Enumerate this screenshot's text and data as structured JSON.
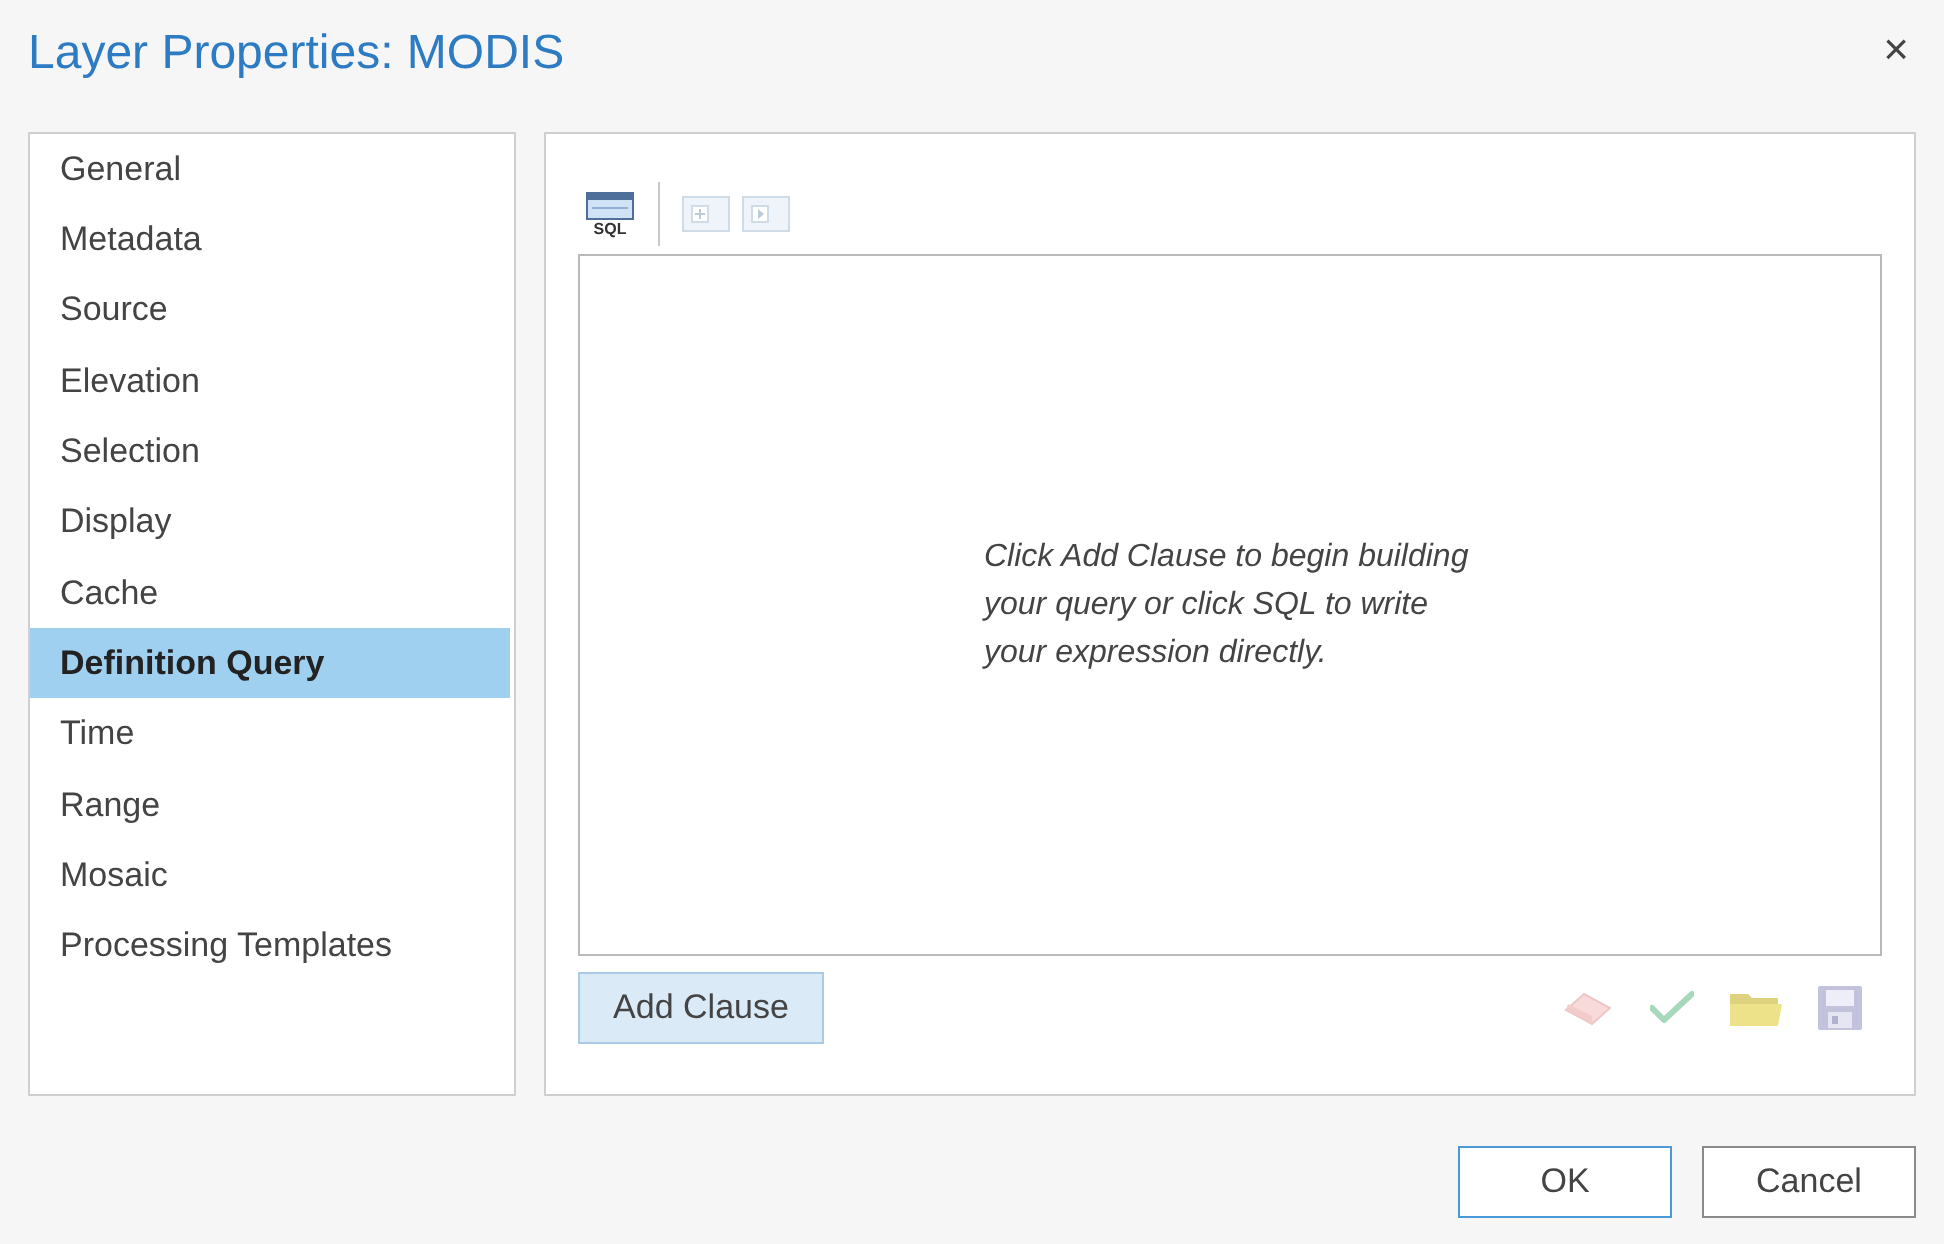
{
  "window": {
    "title": "Layer Properties: MODIS",
    "close_label": "×"
  },
  "sidebar": {
    "items": [
      {
        "label": "General",
        "selected": false
      },
      {
        "label": "Metadata",
        "selected": false
      },
      {
        "label": "Source",
        "selected": false
      },
      {
        "label": "Elevation",
        "selected": false
      },
      {
        "label": "Selection",
        "selected": false
      },
      {
        "label": "Display",
        "selected": false
      },
      {
        "label": "Cache",
        "selected": false
      },
      {
        "label": "Definition Query",
        "selected": true
      },
      {
        "label": "Time",
        "selected": false
      },
      {
        "label": "Range",
        "selected": false
      },
      {
        "label": "Mosaic",
        "selected": false
      },
      {
        "label": "Processing Templates",
        "selected": false
      }
    ]
  },
  "toolbar": {
    "buttons": [
      {
        "kind": "sql",
        "label": "SQL",
        "disabled": false
      },
      {
        "kind": "add_clause",
        "disabled": true
      },
      {
        "kind": "add_group",
        "disabled": true
      }
    ]
  },
  "query_area": {
    "hint": "Click Add Clause to begin building your query or click SQL to write your expression directly."
  },
  "add_clause_button": {
    "label": "Add Clause"
  },
  "actions": [
    {
      "kind": "clear"
    },
    {
      "kind": "verify"
    },
    {
      "kind": "load"
    },
    {
      "kind": "save"
    }
  ],
  "footer": {
    "buttons": [
      {
        "label": "OK",
        "default": true
      },
      {
        "label": "Cancel",
        "default": false
      }
    ]
  }
}
